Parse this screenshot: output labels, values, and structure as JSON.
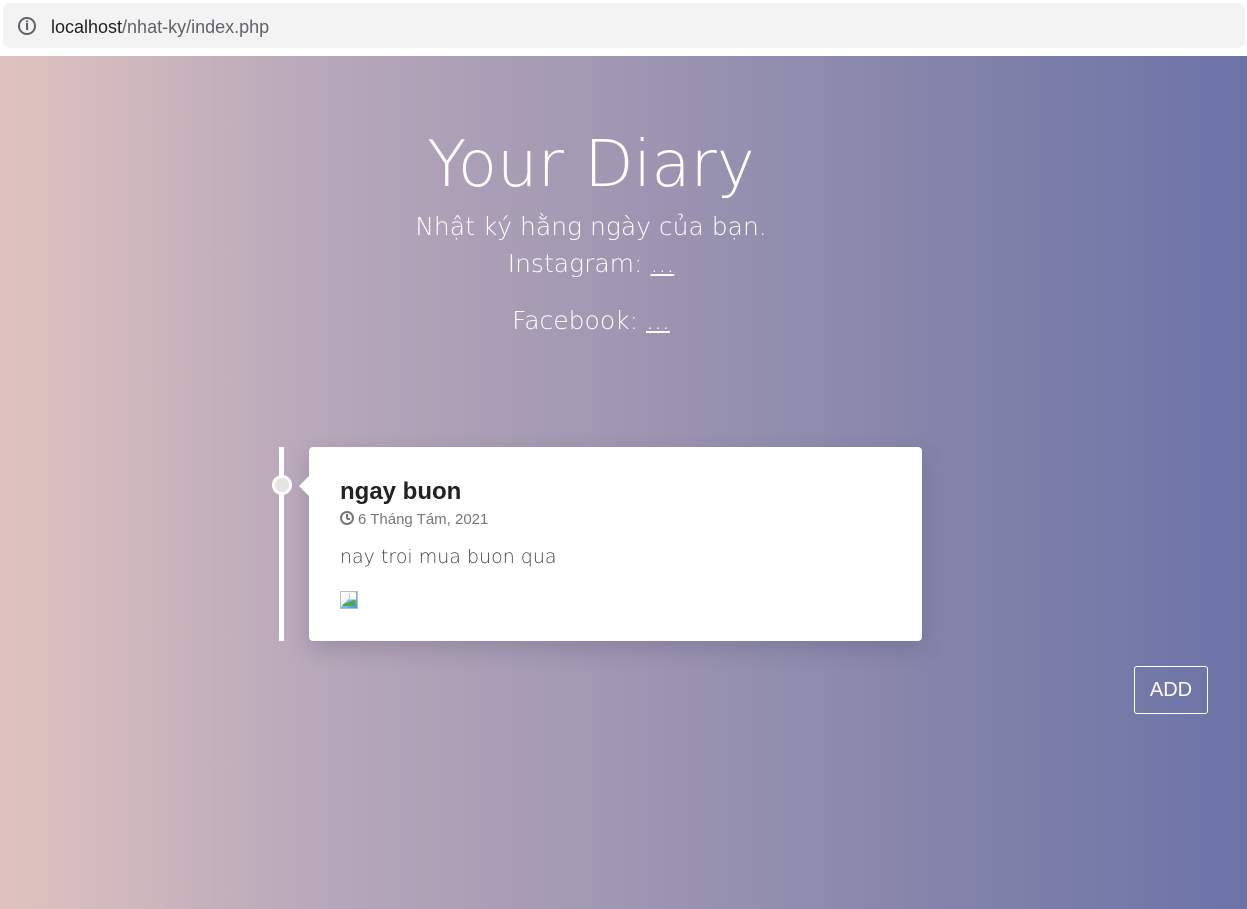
{
  "browser": {
    "url_host": "localhost",
    "url_path": "/nhat-ky/index.php",
    "info_icon": "info-icon"
  },
  "hero": {
    "title": "Your Diary",
    "subtitle": "Nhật ký hằng ngày của bạn.",
    "instagram_label": "Instagram:",
    "instagram_link": "...",
    "facebook_label": "Facebook:",
    "facebook_link": "..."
  },
  "entry": {
    "title": "ngay buon",
    "date": "6 Tháng Tám, 2021",
    "date_icon": "clock-icon",
    "body": "nay troi mua buon qua",
    "image_icon": "broken-image-icon"
  },
  "actions": {
    "add_label": "ADD"
  },
  "colors": {
    "gradient_left": "#e0c3bf",
    "gradient_right": "#6c73a7",
    "card_background": "#ffffff",
    "text_white": "#ffffff"
  }
}
